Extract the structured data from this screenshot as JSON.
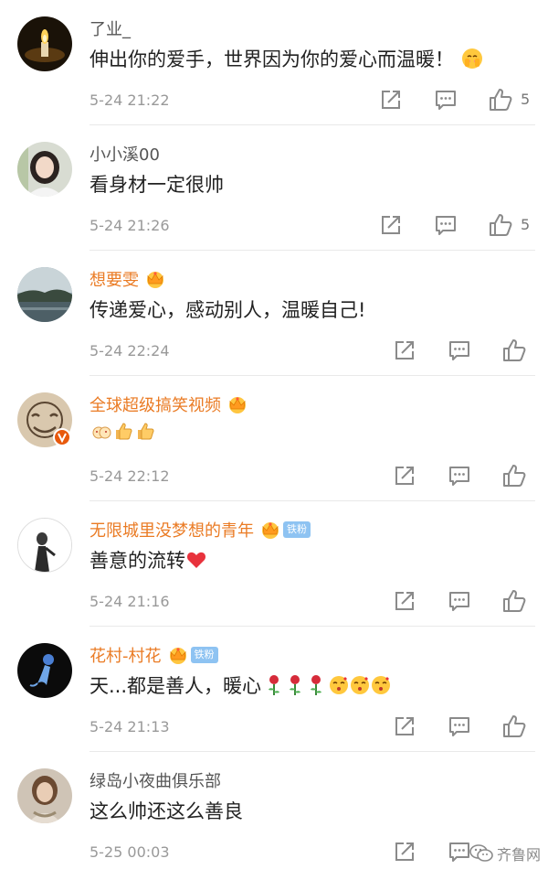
{
  "comments": [
    {
      "username": "了业_",
      "text": "伸出你的爱手，世界因为你的爱心而温暖！",
      "time": "5-24 21:22",
      "likes": "5"
    },
    {
      "username": "小小溪00",
      "text": "看身材一定很帅",
      "time": "5-24 21:26",
      "likes": "5"
    },
    {
      "username": "想要雯",
      "text": "传递爱心，感动别人，温暖自己!",
      "time": "5-24 22:24"
    },
    {
      "username": "全球超级搞笑视频",
      "text": "",
      "time": "5-24 22:12"
    },
    {
      "username": "无限城里没梦想的青年",
      "badge": "铁粉",
      "text": "善意的流转",
      "time": "5-24 21:16"
    },
    {
      "username": "花村-村花",
      "badge": "铁粉",
      "text": "天...都是善人，暖心",
      "time": "5-24 21:13"
    },
    {
      "username": "绿岛小夜曲俱乐部",
      "text": "这么帅还这么善良",
      "time": "5-25 00:03"
    }
  ],
  "watermark": {
    "text": "齐鲁网"
  },
  "colors": {
    "vip_name": "#ea7b24",
    "normal_name": "#555555",
    "time": "#999999",
    "icon": "#8a8a8a",
    "fan_badge": "#8ec3f2"
  },
  "icons": [
    "repost-icon",
    "comment-icon",
    "like-icon",
    "crown-icon",
    "wechat-icon"
  ]
}
